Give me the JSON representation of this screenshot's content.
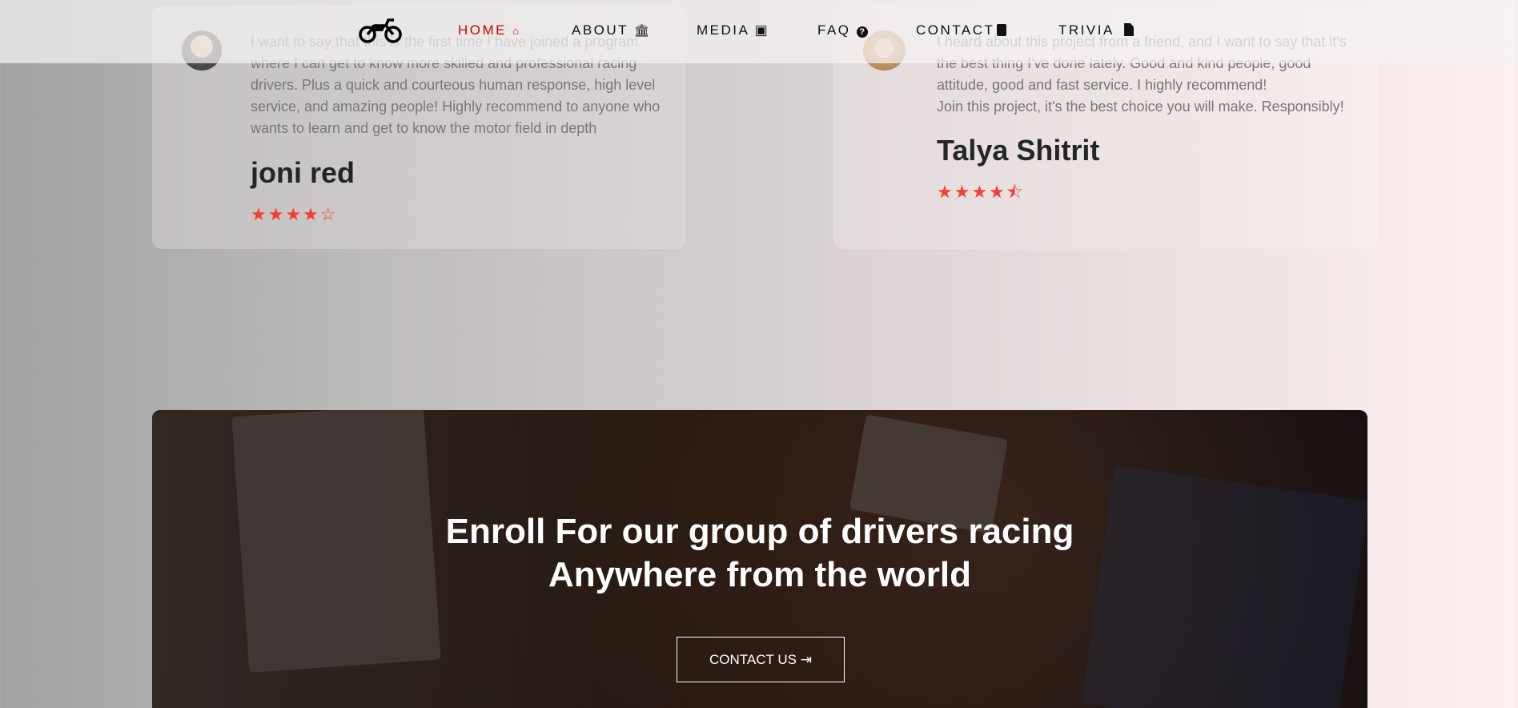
{
  "nav": {
    "items": [
      {
        "label": "HOME",
        "icon": "home-icon",
        "glyph": "🏠",
        "active": true
      },
      {
        "label": "ABOUT",
        "icon": "bank-icon",
        "glyph": "🏛"
      },
      {
        "label": "MEDIA",
        "icon": "image-icon",
        "glyph": "▣"
      },
      {
        "label": "FAQ",
        "icon": "question-circle-icon",
        "glyph": "?"
      },
      {
        "label": "CONTACT",
        "icon": "contact-card-icon",
        "glyph": "▮"
      },
      {
        "label": "TRIVIA",
        "icon": "file-icon",
        "glyph": "▤"
      }
    ],
    "active_color": "#cc0000"
  },
  "testimonials": [
    {
      "quote": "I want to say that this is the first time I have joined a program where I can get to know more skilled and professional racing drivers. Plus a quick and courteous human response, high level service, and amazing people! Highly recommend to anyone who wants to learn and get to know the motor field in depth",
      "name": "joni red",
      "rating": 4,
      "stars": "★★★★☆"
    },
    {
      "quote": "I heard about this project from a friend, and I want to say that it's the best thing I've done lately. Good and kind people, good attitude, good and fast service. I highly recommend!\nJoin this project, it's the best choice you will make. Responsibly!",
      "name": "Talya Shitrit",
      "rating": 4.5,
      "stars": "★★★★⯪"
    }
  ],
  "banner": {
    "title_line1": "Enroll For our group of drivers racing",
    "title_line2": "Anywhere from the world",
    "cta": "CONTACT US",
    "cta_icon": "sign-in-icon"
  },
  "colors": {
    "star": "#f33f33",
    "name": "#222529"
  }
}
